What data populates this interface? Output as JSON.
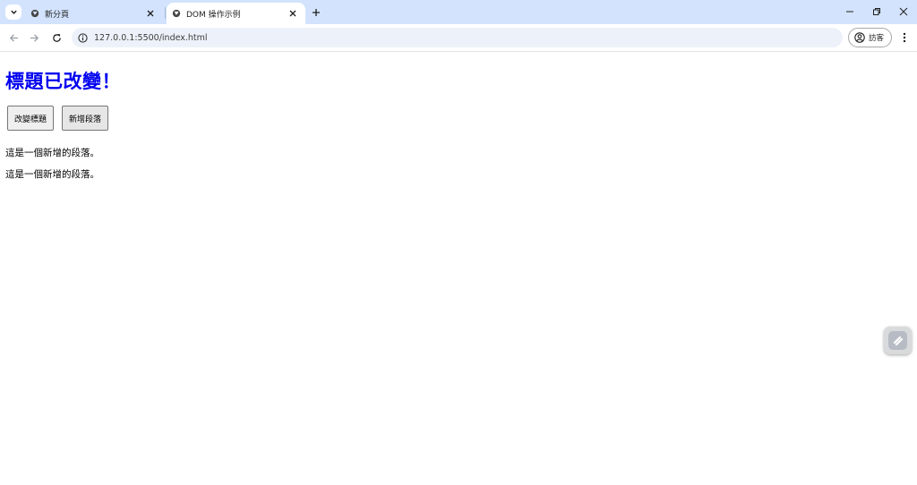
{
  "browser": {
    "tabs": [
      {
        "title": "新分頁",
        "active": false
      },
      {
        "title": "DOM 操作示例",
        "active": true
      }
    ],
    "address_bar": {
      "url": "127.0.0.1:5500/index.html"
    },
    "profile": {
      "label": "訪客"
    }
  },
  "page": {
    "heading": "標題已改變！",
    "buttons": [
      {
        "label": "改變標題"
      },
      {
        "label": "新增段落"
      }
    ],
    "paragraphs": [
      "這是一個新增的段落。",
      "這是一個新增的段落。"
    ]
  },
  "colors": {
    "heading": "#0000ee",
    "tabstrip": "#d3e3fd",
    "omnibox": "#edf2fa"
  },
  "icons": [
    "tab-search-icon",
    "globe-icon",
    "close-icon",
    "plus-icon",
    "minimize-icon",
    "restore-icon",
    "back-arrow-icon",
    "forward-arrow-icon",
    "reload-icon",
    "site-info-icon",
    "account-icon",
    "more-vert-icon",
    "extension-icon"
  ]
}
